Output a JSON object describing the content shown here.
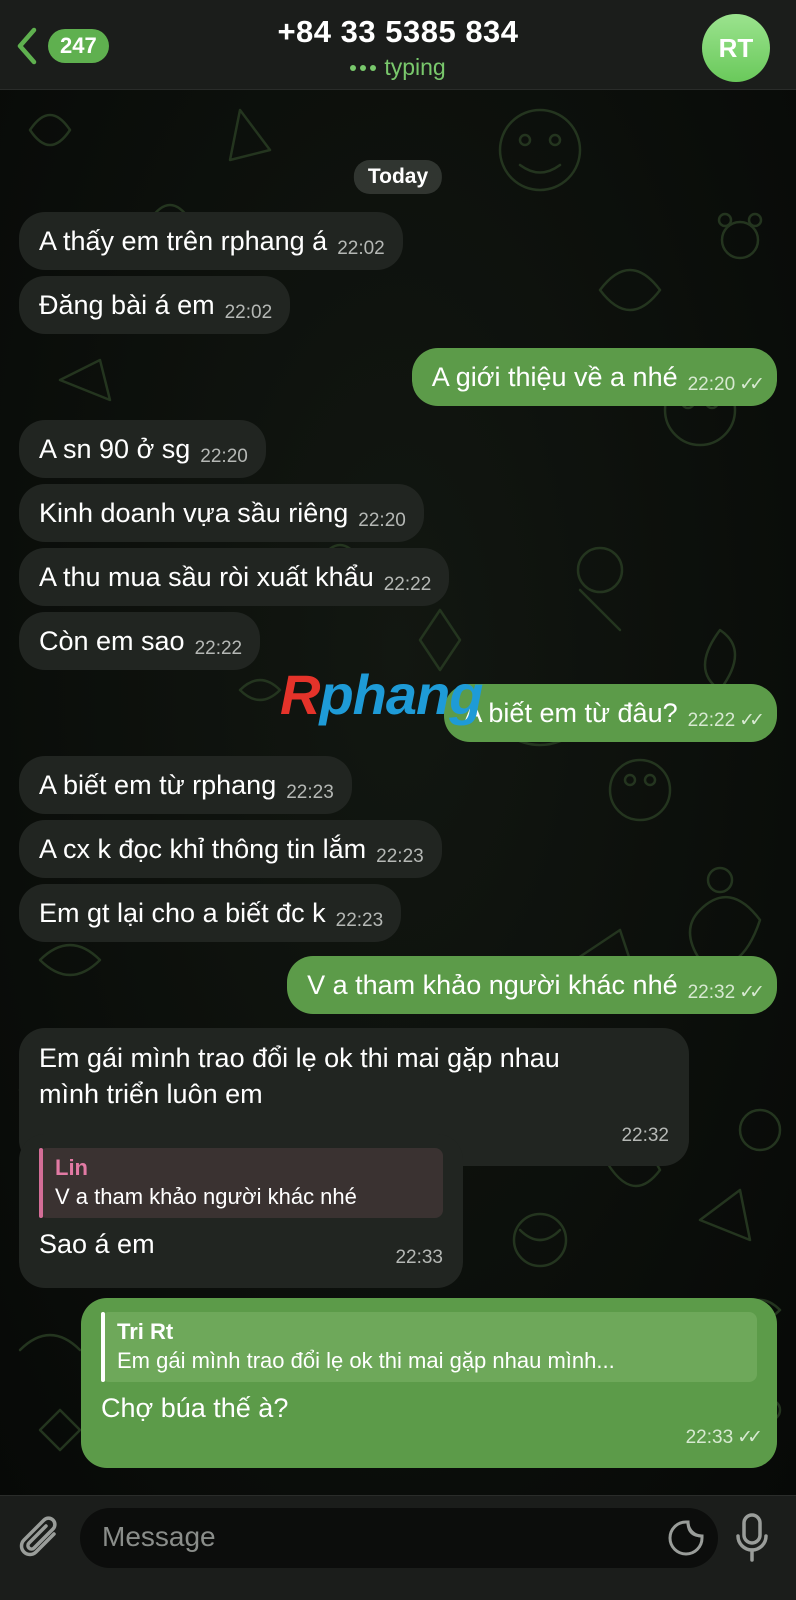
{
  "header": {
    "back_count": "247",
    "title": "+84 33 5385 834",
    "status": "typing",
    "avatar_initials": "RT"
  },
  "chat": {
    "date_label": "Today",
    "messages": [
      {
        "dir": "in",
        "text": "A thấy em trên rphang á",
        "time": "22:02"
      },
      {
        "dir": "in",
        "text": "Đăng bài á em",
        "time": "22:02"
      },
      {
        "dir": "out",
        "text": "A giới thiệu về a nhé",
        "time": "22:20"
      },
      {
        "dir": "in",
        "text": "A sn 90 ở sg",
        "time": "22:20"
      },
      {
        "dir": "in",
        "text": "Kinh doanh vựa sầu riêng",
        "time": "22:20"
      },
      {
        "dir": "in",
        "text": "A thu mua sầu ròi xuất khẩu",
        "time": "22:22"
      },
      {
        "dir": "in",
        "text": "Còn em sao",
        "time": "22:22"
      },
      {
        "dir": "out",
        "text": "A biết em từ đâu?",
        "time": "22:22"
      },
      {
        "dir": "in",
        "text": "A biết em từ rphang",
        "time": "22:23"
      },
      {
        "dir": "in",
        "text": "A cx k đọc khỉ thông tin lắm",
        "time": "22:23"
      },
      {
        "dir": "in",
        "text": "Em gt lại cho a biết đc k",
        "time": "22:23"
      },
      {
        "dir": "out",
        "text": "V a tham khảo người khác nhé",
        "time": "22:32"
      },
      {
        "dir": "in",
        "text_line1": "Em gái mình trao đổi lẹ ok thi mai gặp nhau",
        "text_line2": "mình triển luôn em",
        "time": "22:32"
      },
      {
        "dir": "in",
        "reply_name": "Lin",
        "reply_text": "V a tham khảo người khác nhé",
        "text": "Sao á em",
        "time": "22:33"
      },
      {
        "dir": "out",
        "reply_name": "Tri Rt",
        "reply_text": "Em gái mình trao đổi lẹ ok thi mai gặp nhau mình...",
        "text": "Chợ búa thế à?",
        "time": "22:33"
      }
    ]
  },
  "watermark": {
    "r": "R",
    "rest": "phang"
  },
  "input": {
    "placeholder": "Message"
  },
  "icons": {
    "back": "chevron-left-icon",
    "attach": "paperclip-icon",
    "sticker": "sticker-icon",
    "mic": "microphone-icon",
    "read": "double-check-icon"
  },
  "colors": {
    "accent": "#5fb04f",
    "outgoing_bubble": "#5c9b49",
    "incoming_bubble": "#212521",
    "status_green": "#79c86c"
  }
}
